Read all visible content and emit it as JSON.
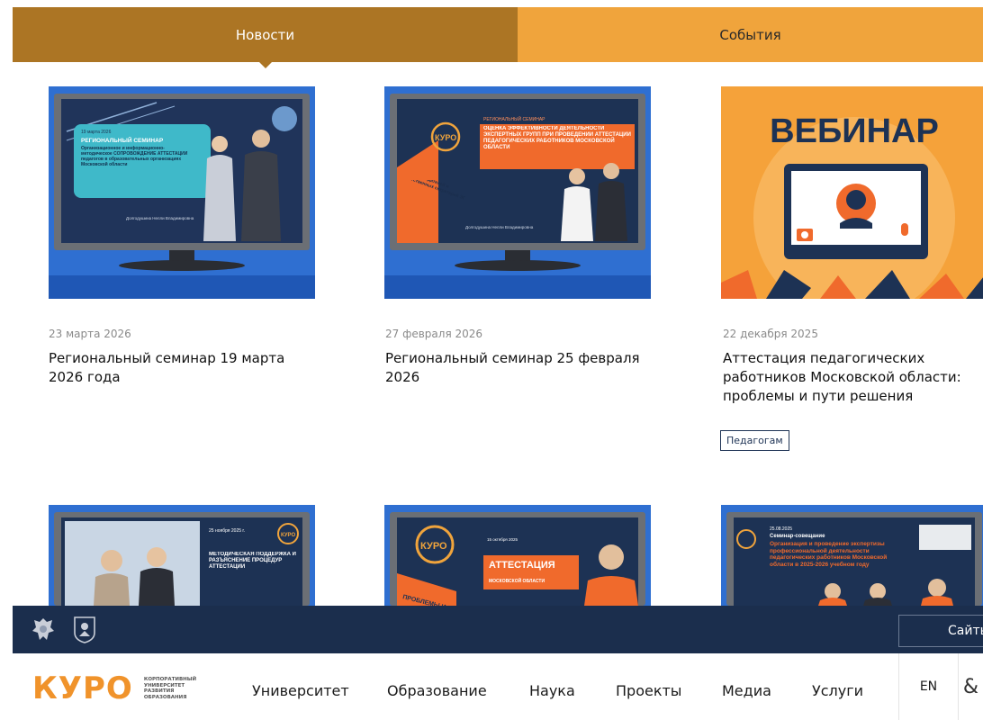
{
  "tabs": [
    {
      "label": "Новости",
      "active": true
    },
    {
      "label": "События",
      "active": false
    }
  ],
  "cards": [
    {
      "date": "23 марта 2026",
      "title": "Региональный семинар 19 марта 2026 года",
      "image": {
        "date_badge": "19 марта 2026",
        "heading": "РЕГИОНАЛЬНЫЙ СЕМИНАР",
        "text": "Организационное и информационно-методическое СОПРОВОЖДЕНИЕ АТТЕСТАЦИИ педагогов в образовательных организациях Московской области",
        "speaker": "Долгодушина Нелли Владимировна"
      }
    },
    {
      "date": "27 февраля 2026",
      "title": "Региональный семинар 25 февраля 2026",
      "image": {
        "logo": "КУРО",
        "heading": "РЕГИОНАЛЬНЫЙ СЕМИНАР",
        "text": "ОЦЕНКА ЭФФЕКТИВНОСТИ ДЕЯТЕЛЬНОСТИ ЭКСПЕРТНЫХ ГРУПП ПРИ ПРОВЕДЕНИИ АТТЕСТАЦИИ ПЕДАГОГИЧЕСКИХ РАБОТНИКОВ МОСКОВСКОЙ ОБЛАСТИ",
        "side": "Для председателей и ответственных секретарей ЭГ",
        "speaker": "Долгодушина Нелли Владимировна"
      }
    },
    {
      "date": "22 декабря 2025",
      "title": "Аттестация педагогических работников Московской области: проблемы и пути решения",
      "tag": "Педагогам",
      "image": {
        "heading": "ВЕБИНАР"
      }
    },
    {
      "image": {
        "date_badge": "25 ноября 2025 г.",
        "logo": "КУРО",
        "text": "МЕТОДИЧЕСКАЯ ПОДДЕРЖКА И РАЗЪЯСНЕНИЕ ПРОЦЕДУР АТТЕСТАЦИИ"
      }
    },
    {
      "image": {
        "logo": "КУРО",
        "date_badge": "15 октября 2025",
        "heading": "АТТЕСТАЦИЯ",
        "text": "МОСКОВСКОЙ ОБЛАСТИ",
        "side": "ПРОБЛЕМЫ И ПУТИ Р"
      }
    },
    {
      "image": {
        "date_badge": "25.08.2025",
        "heading": "Семинар-совещание",
        "text": "Организация и проведение экспертизы профессиональной деятельности педагогических работников Московской области в 2025-2026 учебном году"
      }
    }
  ],
  "header_bar": {
    "site_button": "Сайты"
  },
  "nav": {
    "logo": "КУРО",
    "logo_sub": [
      "КОРПОРАТИВНЫЙ",
      "УНИВЕРСИТЕТ",
      "РАЗВИТИЯ",
      "ОБРАЗОВАНИЯ"
    ],
    "items": [
      "Университет",
      "Образование",
      "Наука",
      "Проекты",
      "Медиа",
      "Услуги"
    ],
    "lang": "EN",
    "right_glyph": "&"
  },
  "colors": {
    "news_tab": "#ac7524",
    "events_tab": "#f0a43c",
    "dark_bar": "#1b2e4d",
    "brand_orange": "#f0932b"
  }
}
